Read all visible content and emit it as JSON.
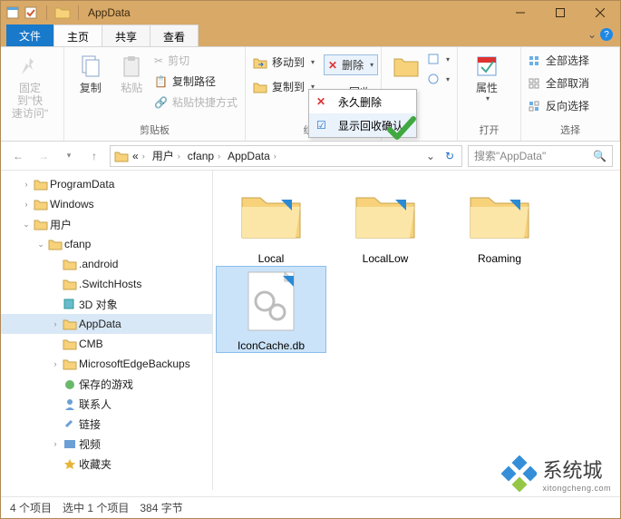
{
  "title": "AppData",
  "tabs": {
    "file": "文件",
    "home": "主页",
    "share": "共享",
    "view": "查看"
  },
  "ribbon": {
    "pin": "固定到\"快\n速访问\"",
    "copy": "复制",
    "paste": "粘贴",
    "cut": "剪切",
    "copypath": "复制路径",
    "pasteshortcut": "粘贴快捷方式",
    "grp_clipboard": "剪贴板",
    "moveto": "移动到",
    "copyto": "复制到",
    "delete": "删除",
    "recycle": "回收",
    "grp_org": "组织",
    "properties": "属性",
    "grp_open": "打开",
    "selectall": "全部选择",
    "selectnone": "全部取消",
    "invert": "反向选择",
    "grp_select": "选择"
  },
  "menu": {
    "permdelete": "永久删除",
    "confirm": "显示回收确认"
  },
  "breadcrumbs": {
    "users": "用户",
    "cfanp": "cfanp",
    "appdata": "AppData"
  },
  "search_placeholder": "搜索\"AppData\"",
  "tree": {
    "programdata": "ProgramData",
    "windows": "Windows",
    "users": "用户",
    "cfanp": "cfanp",
    "android": ".android",
    "switchhosts": ".SwitchHosts",
    "threed": "3D 对象",
    "appdata": "AppData",
    "cmb": "CMB",
    "edgebackups": "MicrosoftEdgeBackups",
    "savedgames": "保存的游戏",
    "contacts": "联系人",
    "links": "链接",
    "videos": "视频",
    "favorites": "收藏夹"
  },
  "items": {
    "local": "Local",
    "locallow": "LocalLow",
    "roaming": "Roaming",
    "iconcache": "IconCache.db"
  },
  "status": {
    "count": "4 个项目",
    "selected": "选中 1 个项目",
    "size": "384 字节"
  },
  "watermark": {
    "text": "系统城",
    "sub": "xitongcheng.com"
  }
}
